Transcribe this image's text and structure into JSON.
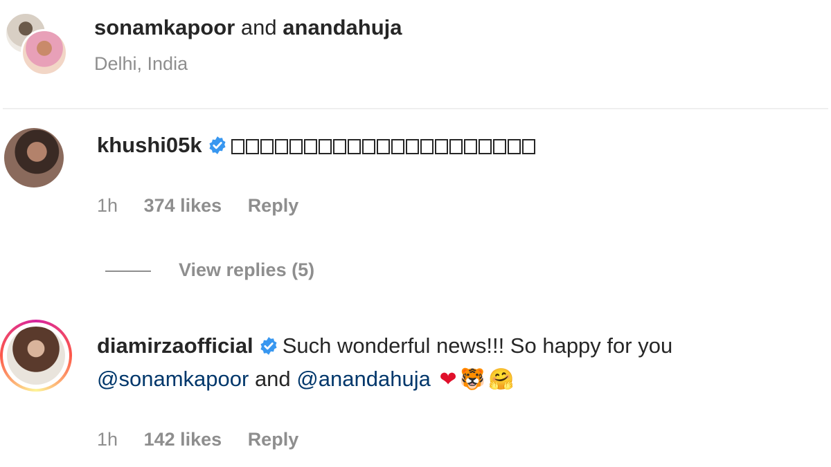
{
  "header": {
    "user1": "sonamkapoor",
    "joiner": "and",
    "user2": "anandahuja",
    "location": "Delhi, India"
  },
  "comments": [
    {
      "username": "khushi05k",
      "verified": true,
      "text_glyph_boxes": 21,
      "time": "1h",
      "likes": "374 likes",
      "reply": "Reply",
      "view_replies": "View replies (5)"
    },
    {
      "username": "diamirzaofficial",
      "verified": true,
      "text": "Such wonderful news!!! So happy for you",
      "mention1": "@sonamkapoor",
      "joiner": "and",
      "mention2": "@anandahuja",
      "emoji_heart": "❤",
      "emoji_tiger": "🐯",
      "emoji_hug": "🤗",
      "time": "1h",
      "likes": "142 likes",
      "reply": "Reply"
    }
  ],
  "colors": {
    "text": "#262626",
    "muted": "#8e8e8e",
    "mention": "#00376b",
    "verified": "#3897f0"
  }
}
